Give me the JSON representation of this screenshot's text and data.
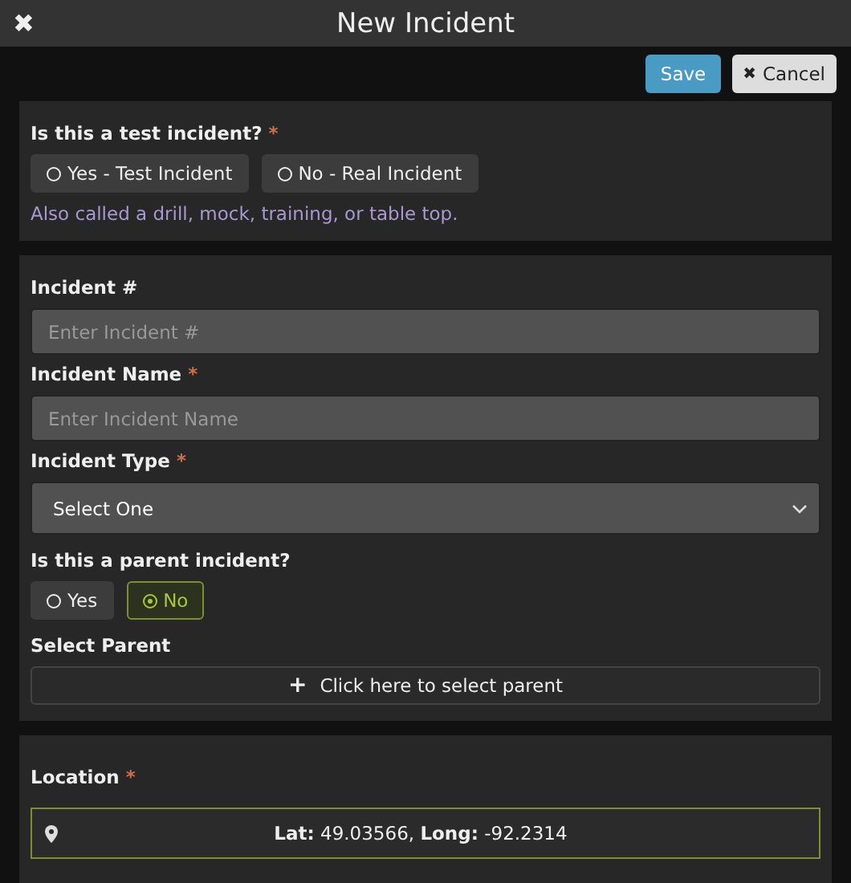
{
  "window": {
    "close_icon": "✖",
    "title": "New Incident"
  },
  "toolbar": {
    "save": "Save",
    "cancel_icon": "✖",
    "cancel": "Cancel"
  },
  "test_section": {
    "label": "Is this a test incident?",
    "required": "*",
    "options": [
      {
        "label": "Yes - Test Incident",
        "selected": false
      },
      {
        "label": "No - Real Incident",
        "selected": false
      }
    ],
    "help": "Also called a drill, mock, training, or table top."
  },
  "details": {
    "fields": [
      {
        "kind": "input",
        "label": "Incident #",
        "placeholder": "Enter Incident #"
      },
      {
        "kind": "input",
        "label": "Incident Name",
        "required": "*",
        "placeholder": "Enter Incident Name"
      },
      {
        "kind": "select",
        "label": "Incident Type",
        "required": "*",
        "value": "Select One"
      }
    ],
    "parent_question": {
      "label": "Is this a parent incident?",
      "options": [
        {
          "label": "Yes",
          "selected": false
        },
        {
          "label": "No",
          "selected": true
        }
      ]
    },
    "select_parent": {
      "label": "Select Parent",
      "button_icon": "+",
      "button": "Click here to select parent"
    }
  },
  "location": {
    "label": "Location",
    "required": "*",
    "value": "**Lat:** 49.03566, **Long:** -92.2314"
  }
}
